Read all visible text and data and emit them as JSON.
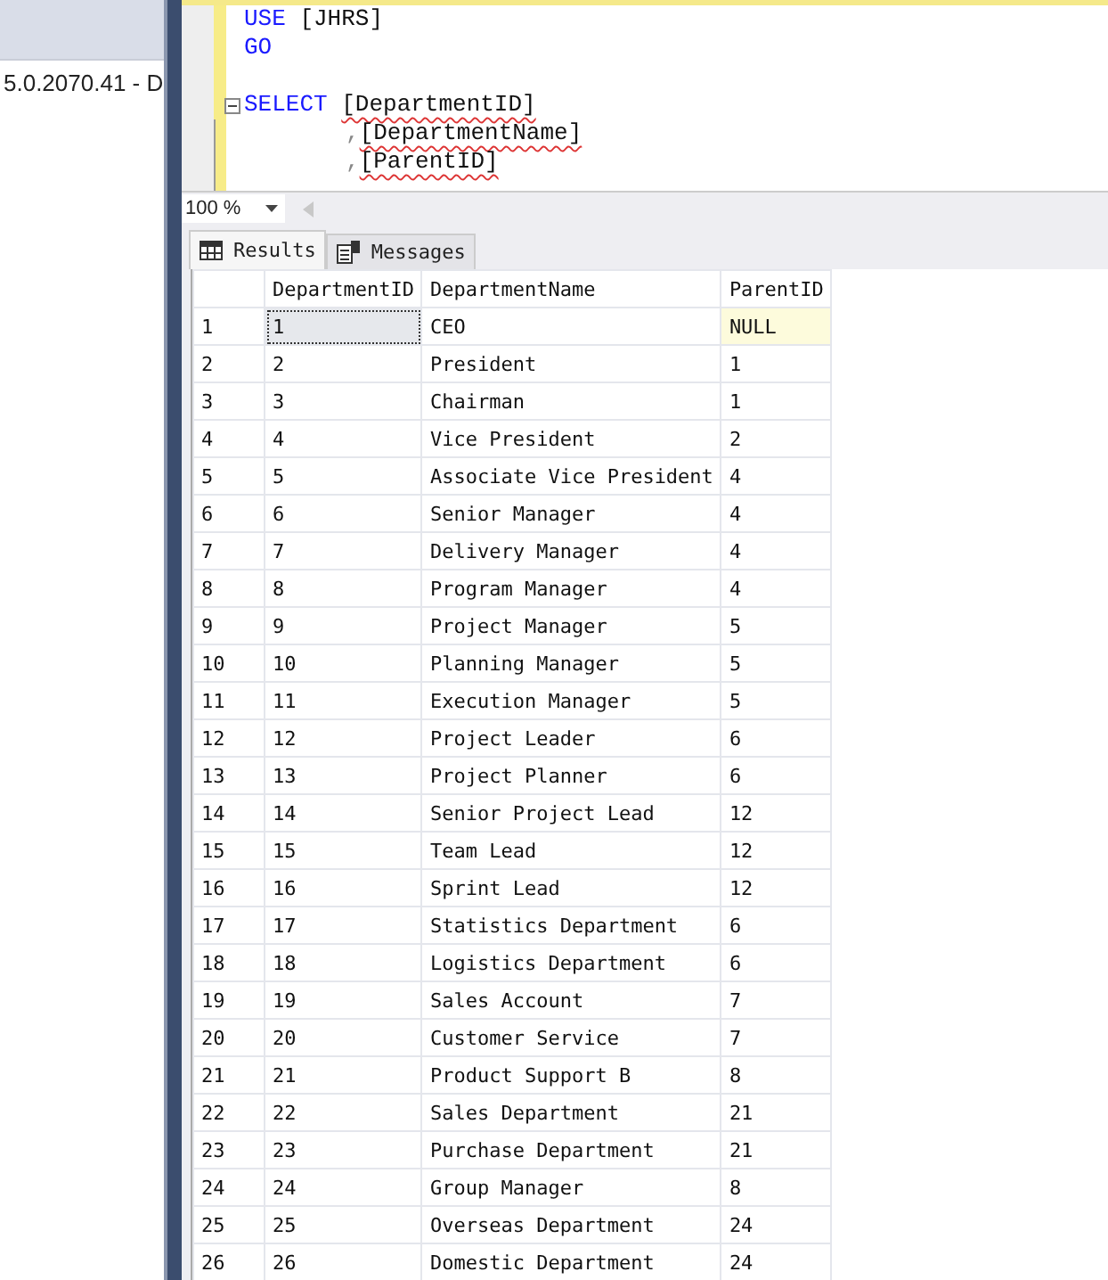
{
  "server_panel": {
    "text": "5.0.2070.41 - D"
  },
  "editor": {
    "lines": [
      {
        "kind": "statement",
        "tokens": [
          {
            "text": "USE",
            "kind": "keyword",
            "squiggle": false
          },
          {
            "text": "[JHRS]",
            "kind": "ident",
            "squiggle": false
          }
        ]
      },
      {
        "kind": "statement",
        "tokens": [
          {
            "text": "GO",
            "kind": "keyword",
            "squiggle": false
          }
        ]
      },
      {
        "kind": "blank"
      },
      {
        "kind": "block_start",
        "tokens": [
          {
            "text": "SELECT",
            "kind": "keyword",
            "squiggle": false
          },
          {
            "text": "[DepartmentID]",
            "kind": "ident",
            "squiggle": true
          }
        ]
      },
      {
        "kind": "continuation",
        "tokens": [
          {
            "text": ",",
            "kind": "punct",
            "squiggle": false
          },
          {
            "text": "[DepartmentName]",
            "kind": "ident",
            "squiggle": true
          }
        ]
      },
      {
        "kind": "continuation",
        "tokens": [
          {
            "text": ",",
            "kind": "punct",
            "squiggle": false
          },
          {
            "text": "[ParentID]",
            "kind": "ident",
            "squiggle": true
          }
        ]
      }
    ]
  },
  "zoom": {
    "value": "100 %"
  },
  "tabs": [
    {
      "label": "Results",
      "selected": true
    },
    {
      "label": "Messages",
      "selected": false
    }
  ],
  "table": {
    "columns": [
      "DepartmentID",
      "DepartmentName",
      "ParentID"
    ],
    "rows": [
      {
        "num": "1",
        "cells": [
          "1",
          "CEO",
          "NULL"
        ],
        "selected": true,
        "is_null": true
      },
      {
        "num": "2",
        "cells": [
          "2",
          "President",
          "1"
        ],
        "selected": false,
        "is_null": false
      },
      {
        "num": "3",
        "cells": [
          "3",
          "Chairman",
          "1"
        ],
        "selected": false,
        "is_null": false
      },
      {
        "num": "4",
        "cells": [
          "4",
          "Vice President",
          "2"
        ],
        "selected": false,
        "is_null": false
      },
      {
        "num": "5",
        "cells": [
          "5",
          "Associate Vice President",
          "4"
        ],
        "selected": false,
        "is_null": false
      },
      {
        "num": "6",
        "cells": [
          "6",
          "Senior Manager",
          "4"
        ],
        "selected": false,
        "is_null": false
      },
      {
        "num": "7",
        "cells": [
          "7",
          "Delivery Manager",
          "4"
        ],
        "selected": false,
        "is_null": false
      },
      {
        "num": "8",
        "cells": [
          "8",
          "Program Manager",
          "4"
        ],
        "selected": false,
        "is_null": false
      },
      {
        "num": "9",
        "cells": [
          "9",
          "Project Manager",
          "5"
        ],
        "selected": false,
        "is_null": false
      },
      {
        "num": "10",
        "cells": [
          "10",
          "Planning Manager",
          "5"
        ],
        "selected": false,
        "is_null": false
      },
      {
        "num": "11",
        "cells": [
          "11",
          "Execution Manager",
          "5"
        ],
        "selected": false,
        "is_null": false
      },
      {
        "num": "12",
        "cells": [
          "12",
          "Project Leader",
          "6"
        ],
        "selected": false,
        "is_null": false
      },
      {
        "num": "13",
        "cells": [
          "13",
          "Project Planner",
          "6"
        ],
        "selected": false,
        "is_null": false
      },
      {
        "num": "14",
        "cells": [
          "14",
          "Senior Project Lead",
          "12"
        ],
        "selected": false,
        "is_null": false
      },
      {
        "num": "15",
        "cells": [
          "15",
          "Team Lead",
          "12"
        ],
        "selected": false,
        "is_null": false
      },
      {
        "num": "16",
        "cells": [
          "16",
          "Sprint Lead",
          "12"
        ],
        "selected": false,
        "is_null": false
      },
      {
        "num": "17",
        "cells": [
          "17",
          "Statistics Department",
          "6"
        ],
        "selected": false,
        "is_null": false
      },
      {
        "num": "18",
        "cells": [
          "18",
          "Logistics Department",
          "6"
        ],
        "selected": false,
        "is_null": false
      },
      {
        "num": "19",
        "cells": [
          "19",
          "Sales Account",
          "7"
        ],
        "selected": false,
        "is_null": false
      },
      {
        "num": "20",
        "cells": [
          "20",
          "Customer Service",
          "7"
        ],
        "selected": false,
        "is_null": false
      },
      {
        "num": "21",
        "cells": [
          "21",
          "Product Support B",
          "8"
        ],
        "selected": false,
        "is_null": false
      },
      {
        "num": "22",
        "cells": [
          "22",
          "Sales Department",
          "21"
        ],
        "selected": false,
        "is_null": false
      },
      {
        "num": "23",
        "cells": [
          "23",
          "Purchase Department",
          "21"
        ],
        "selected": false,
        "is_null": false
      },
      {
        "num": "24",
        "cells": [
          "24",
          "Group Manager",
          "8"
        ],
        "selected": false,
        "is_null": false
      },
      {
        "num": "25",
        "cells": [
          "25",
          "Overseas Department",
          "24"
        ],
        "selected": false,
        "is_null": false
      },
      {
        "num": "26",
        "cells": [
          "26",
          "Domestic Department",
          "24"
        ],
        "selected": false,
        "is_null": false
      }
    ]
  }
}
